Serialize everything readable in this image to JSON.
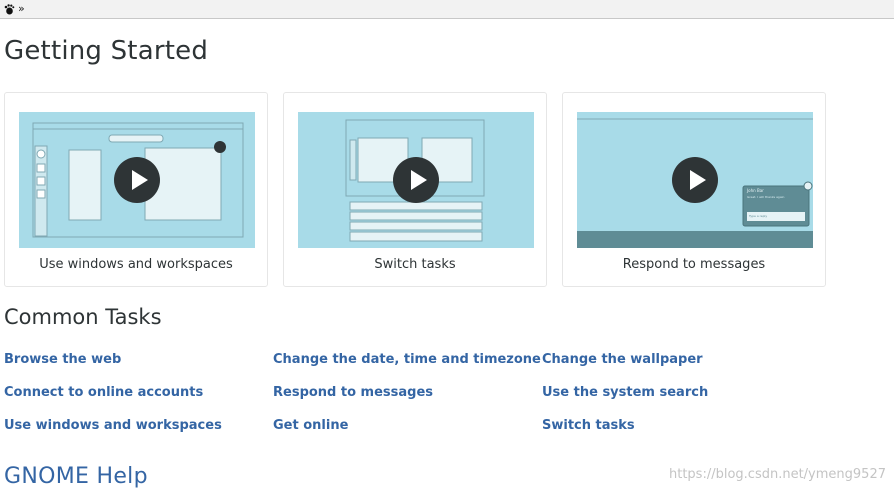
{
  "toolbar": {
    "chevron": "»",
    "icon": "gnome-foot-icon"
  },
  "getting_started": {
    "title": "Getting Started",
    "cards": [
      {
        "caption": "Use windows and workspaces"
      },
      {
        "caption": "Switch tasks"
      },
      {
        "caption": "Respond to messages",
        "notification_name": "John Bar",
        "notification_text": "Great. I will thanks again",
        "notification_reply": "Type a reply"
      }
    ]
  },
  "common_tasks": {
    "title": "Common Tasks",
    "links": [
      [
        "Browse the web",
        "Change the date, time and timezone",
        "Change the wallpaper"
      ],
      [
        "Connect to online accounts",
        "Respond to messages",
        "Use the system search"
      ],
      [
        "Use windows and workspaces",
        "Get online",
        "Switch tasks"
      ]
    ]
  },
  "footer": {
    "title": "GNOME Help"
  },
  "watermark": "https://blog.csdn.net/ymeng9527",
  "colors": {
    "link": "#3465a4",
    "thumb_bg": "#a8dbe8",
    "play": "#2e3436"
  }
}
